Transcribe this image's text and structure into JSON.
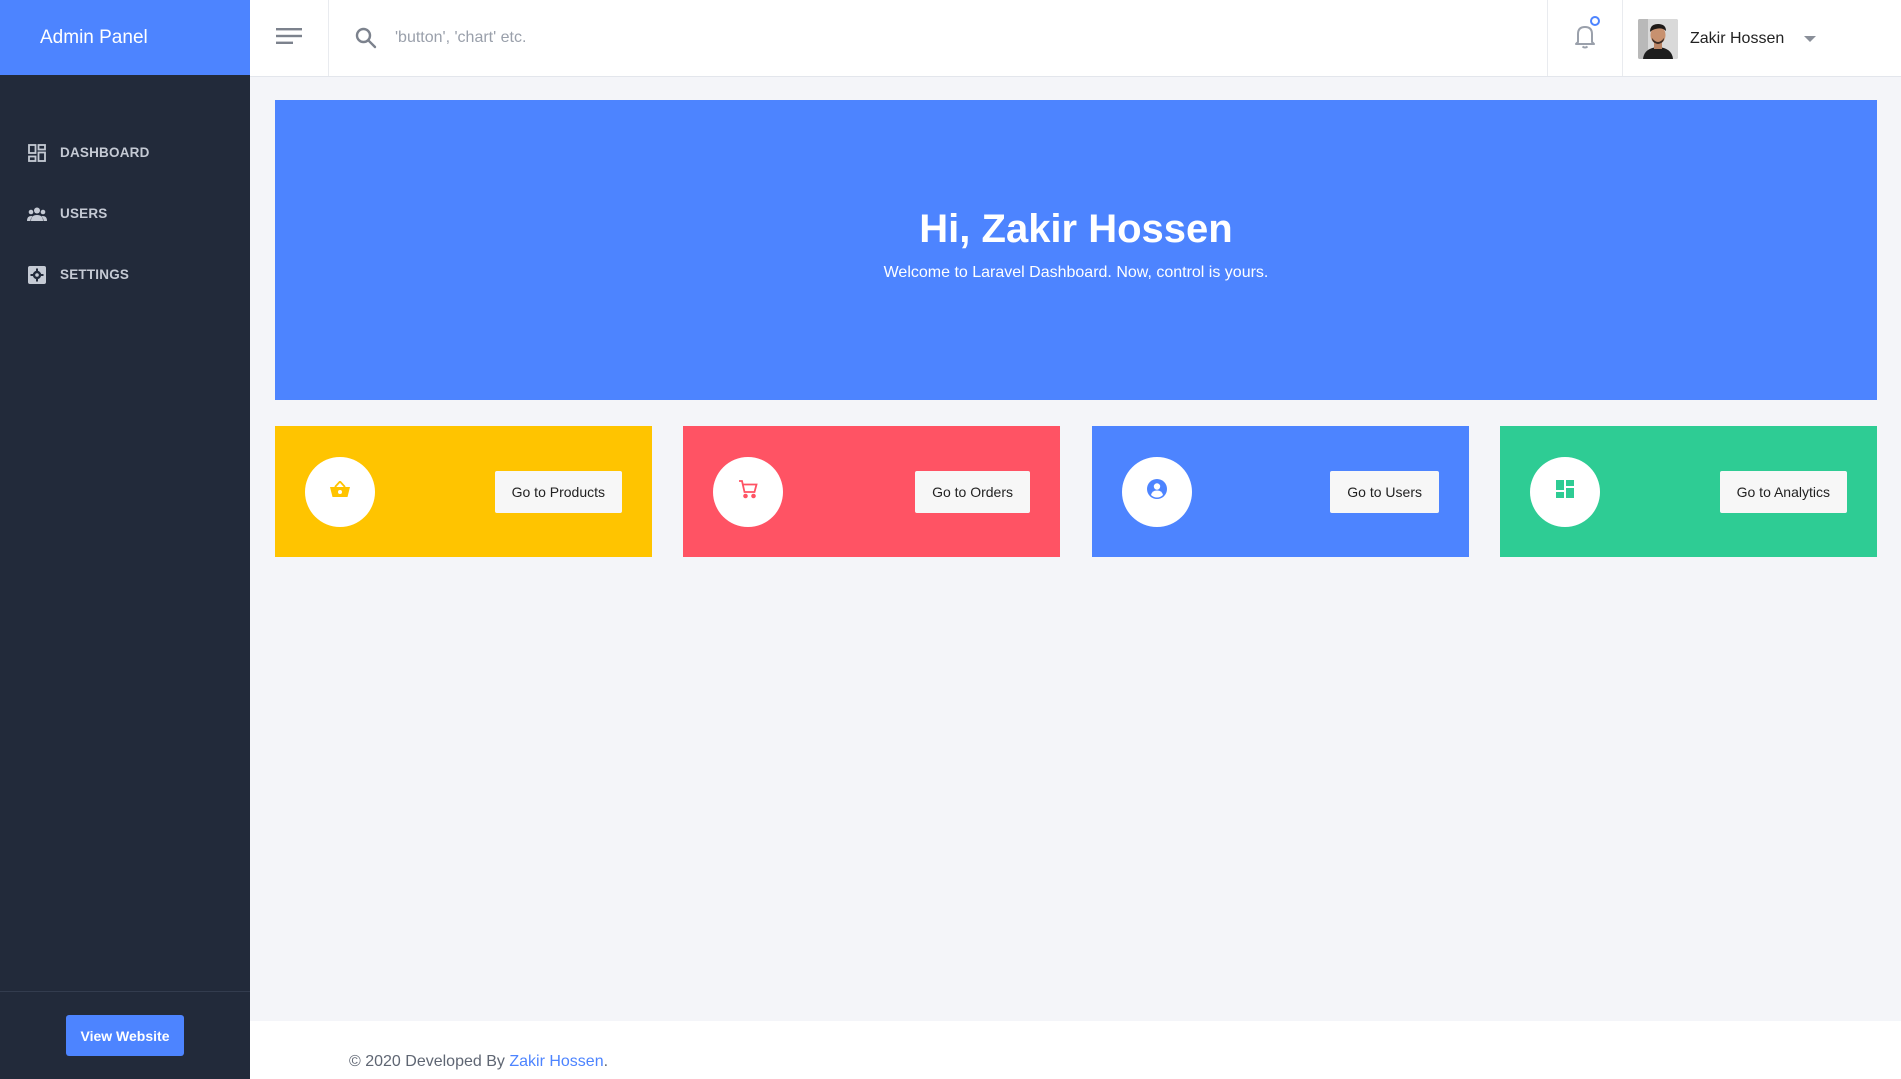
{
  "sidebar": {
    "brand": "Admin Panel",
    "items": [
      {
        "label": "DASHBOARD",
        "icon": "dashboard-icon"
      },
      {
        "label": "USERS",
        "icon": "users-icon"
      },
      {
        "label": "SETTINGS",
        "icon": "settings-icon"
      }
    ],
    "view_website": "View Website"
  },
  "topbar": {
    "search_placeholder": "'button', 'chart' etc.",
    "user_name": "Zakir Hossen"
  },
  "hero": {
    "title": "Hi, Zakir Hossen",
    "subtitle": "Welcome to Laravel Dashboard. Now, control is yours."
  },
  "cards": [
    {
      "button": "Go to Products",
      "icon": "basket-icon",
      "color": "#ffc400"
    },
    {
      "button": "Go to Orders",
      "icon": "cart-icon",
      "color": "#ff5364"
    },
    {
      "button": "Go to Users",
      "icon": "user-circle-icon",
      "color": "#4d84ff"
    },
    {
      "button": "Go to Analytics",
      "icon": "analytics-icon",
      "color": "#2ecc94"
    }
  ],
  "footer": {
    "prefix": "© 2020 Developed By ",
    "author": "Zakir Hossen",
    "suffix": "."
  },
  "colors": {
    "accent": "#4d84ff",
    "sidebar_bg": "#222a3a",
    "page_bg": "#f4f5f9"
  }
}
